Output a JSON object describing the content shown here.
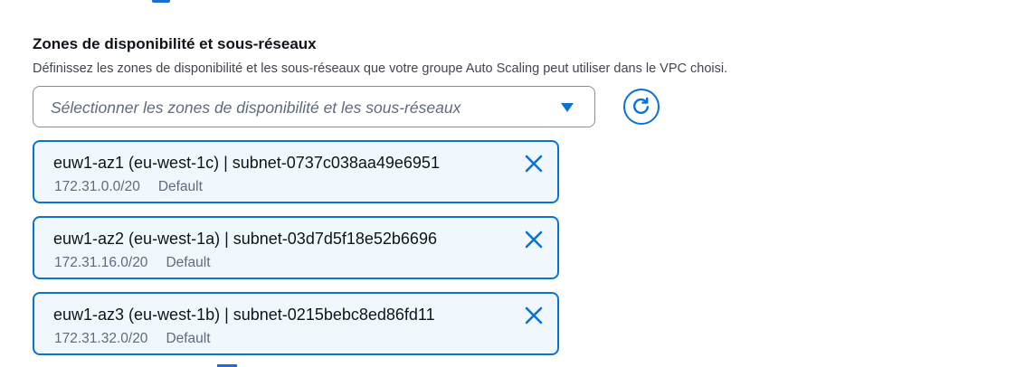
{
  "field": {
    "label": "Zones de disponibilité et sous-réseaux",
    "description": "Définissez les zones de disponibilité et les sous-réseaux que votre groupe Auto Scaling peut utiliser dans le VPC choisi.",
    "placeholder": "Sélectionner les zones de disponibilité et les sous-réseaux"
  },
  "icons": {
    "caret": "caret-down-icon",
    "refresh": "refresh-icon",
    "dismiss": "close-icon"
  },
  "colors": {
    "accent": "#0972d3",
    "token_background": "#f1f8fd",
    "secondary_text": "#5f6b7a"
  },
  "selected": [
    {
      "title": "euw1-az1 (eu-west-1c) | subnet-0737c038aa49e6951",
      "cidr": "172.31.0.0/20",
      "tag": "Default"
    },
    {
      "title": "euw1-az2 (eu-west-1a) | subnet-03d7d5f18e52b6696",
      "cidr": "172.31.16.0/20",
      "tag": "Default"
    },
    {
      "title": "euw1-az3 (eu-west-1b) | subnet-0215bebc8ed86fd11",
      "cidr": "172.31.32.0/20",
      "tag": "Default"
    }
  ]
}
